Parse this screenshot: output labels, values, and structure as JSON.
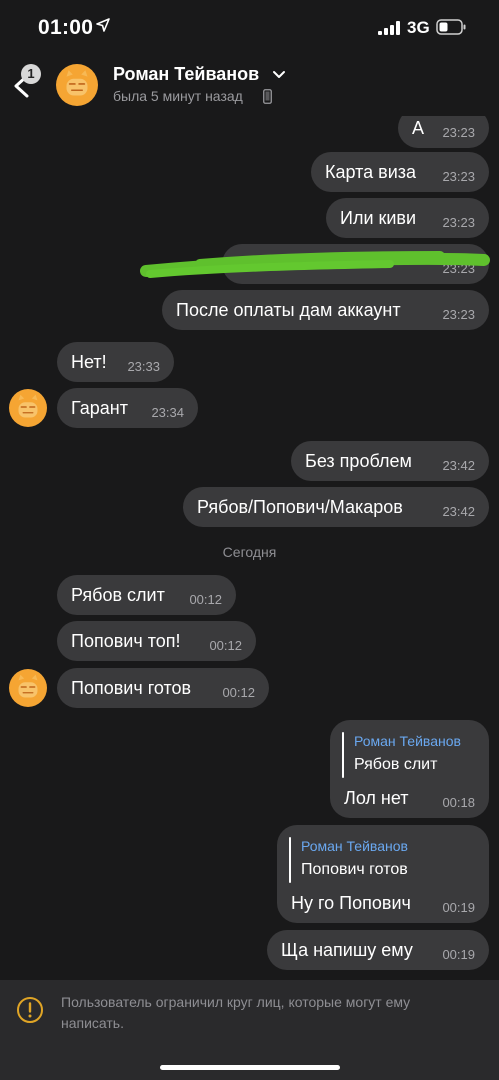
{
  "status_bar": {
    "time": "01:00",
    "network": "3G"
  },
  "header": {
    "back_badge": "1",
    "contact_name": "Роман Тейванов",
    "last_seen": "была 5 минут назад"
  },
  "messages": [
    {
      "text": "А",
      "time": "23:23",
      "out": true
    },
    {
      "text": "Карта виза",
      "time": "23:23",
      "out": true
    },
    {
      "text": "Или киви",
      "time": "23:23",
      "out": true
    },
    {
      "text": "",
      "time": "23:23",
      "out": true,
      "redacted": true
    },
    {
      "text": "После оплаты дам аккаунт",
      "time": "23:23",
      "out": true
    },
    {
      "text": "Нет!",
      "time": "23:33",
      "out": false
    },
    {
      "text": "Гарант",
      "time": "23:34",
      "out": false
    },
    {
      "text": "Без проблем",
      "time": "23:42",
      "out": true
    },
    {
      "text": "Рябов/Попович/Макаров",
      "time": "23:42",
      "out": true
    },
    {
      "text": "Рябов слит",
      "time": "00:12",
      "out": false
    },
    {
      "text": "Попович топ!",
      "time": "00:12",
      "out": false
    },
    {
      "text": "Попович готов",
      "time": "00:12",
      "out": false
    },
    {
      "text": "Лол нет",
      "time": "00:18",
      "out": true,
      "reply_to": {
        "author": "Роман Тейванов",
        "text": "Рябов слит"
      }
    },
    {
      "text": "Ну го Попович",
      "time": "00:19",
      "out": true,
      "reply_to": {
        "author": "Роман Тейванов",
        "text": "Попович готов"
      }
    },
    {
      "text": "Ща напишу ему",
      "time": "00:19",
      "out": true
    }
  ],
  "day_separator": "Сегодня",
  "footer": {
    "notice": "Пользователь ограничил круг лиц, которые могут ему написать."
  },
  "colors": {
    "background": "#19191a",
    "bubble": "#3a3a3c",
    "reply_author": "#6aa8f0",
    "avatar": "#f5a533",
    "redaction": "#5fc02d"
  }
}
